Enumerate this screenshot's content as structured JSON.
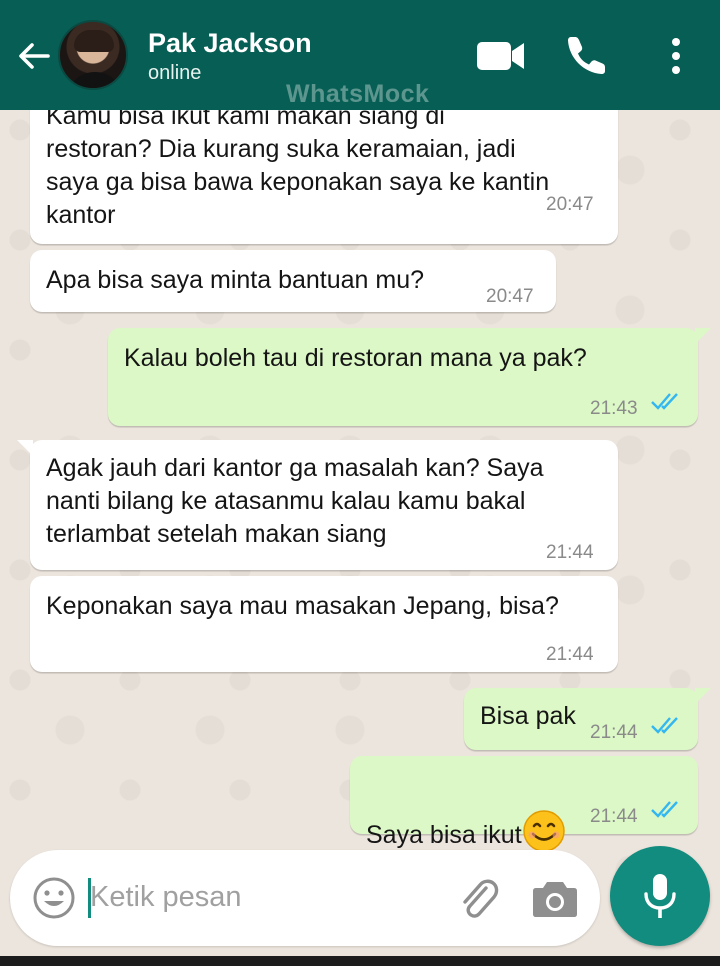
{
  "header": {
    "contact_name": "Pak Jackson",
    "status": "online",
    "watermark": "WhatsMock"
  },
  "colors": {
    "header": "#075e54",
    "outgoing_bubble": "#dcf8c6",
    "incoming_bubble": "#ffffff",
    "accent": "#128c7e",
    "read_ticks": "#34b7f1"
  },
  "messages": [
    {
      "direction": "incoming",
      "text": "Kamu bisa ikut kami makan siang di\nrestoran? Dia kurang suka keramaian, jadi\nsaya ga bisa bawa keponakan saya ke kantin\nkantor",
      "time": "20:47"
    },
    {
      "direction": "incoming",
      "text": "Apa bisa saya minta bantuan mu?",
      "time": "20:47"
    },
    {
      "direction": "outgoing",
      "text": "Kalau boleh tau di restoran mana ya pak?",
      "time": "21:43",
      "status": "read"
    },
    {
      "direction": "incoming",
      "text": "Agak jauh dari kantor ga masalah kan? Saya\nnanti bilang ke atasanmu kalau kamu bakal\nterlambat setelah makan siang",
      "time": "21:44"
    },
    {
      "direction": "incoming",
      "text": "Keponakan saya mau masakan Jepang, bisa?",
      "time": "21:44"
    },
    {
      "direction": "outgoing",
      "text": "Bisa pak",
      "time": "21:44",
      "status": "read"
    },
    {
      "direction": "outgoing",
      "text": "Saya bisa ikut",
      "emoji": "smiling-face-icon",
      "time": "21:44",
      "status": "read"
    }
  ],
  "input": {
    "placeholder": "Ketik pesan"
  },
  "icons": {
    "back": "arrow-left-icon",
    "video": "video-camera-icon",
    "call": "phone-icon",
    "menu": "more-vertical-icon",
    "emoji": "emoji-icon",
    "attach": "paperclip-icon",
    "camera": "camera-icon",
    "mic": "microphone-icon"
  }
}
